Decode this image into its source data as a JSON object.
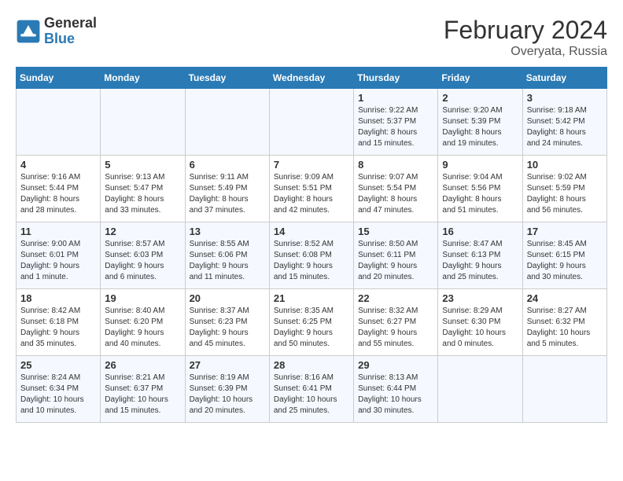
{
  "header": {
    "logo_general": "General",
    "logo_blue": "Blue",
    "month_year": "February 2024",
    "location": "Overyata, Russia"
  },
  "days_of_week": [
    "Sunday",
    "Monday",
    "Tuesday",
    "Wednesday",
    "Thursday",
    "Friday",
    "Saturday"
  ],
  "weeks": [
    [
      {
        "day": "",
        "info": ""
      },
      {
        "day": "",
        "info": ""
      },
      {
        "day": "",
        "info": ""
      },
      {
        "day": "",
        "info": ""
      },
      {
        "day": "1",
        "info": "Sunrise: 9:22 AM\nSunset: 5:37 PM\nDaylight: 8 hours\nand 15 minutes."
      },
      {
        "day": "2",
        "info": "Sunrise: 9:20 AM\nSunset: 5:39 PM\nDaylight: 8 hours\nand 19 minutes."
      },
      {
        "day": "3",
        "info": "Sunrise: 9:18 AM\nSunset: 5:42 PM\nDaylight: 8 hours\nand 24 minutes."
      }
    ],
    [
      {
        "day": "4",
        "info": "Sunrise: 9:16 AM\nSunset: 5:44 PM\nDaylight: 8 hours\nand 28 minutes."
      },
      {
        "day": "5",
        "info": "Sunrise: 9:13 AM\nSunset: 5:47 PM\nDaylight: 8 hours\nand 33 minutes."
      },
      {
        "day": "6",
        "info": "Sunrise: 9:11 AM\nSunset: 5:49 PM\nDaylight: 8 hours\nand 37 minutes."
      },
      {
        "day": "7",
        "info": "Sunrise: 9:09 AM\nSunset: 5:51 PM\nDaylight: 8 hours\nand 42 minutes."
      },
      {
        "day": "8",
        "info": "Sunrise: 9:07 AM\nSunset: 5:54 PM\nDaylight: 8 hours\nand 47 minutes."
      },
      {
        "day": "9",
        "info": "Sunrise: 9:04 AM\nSunset: 5:56 PM\nDaylight: 8 hours\nand 51 minutes."
      },
      {
        "day": "10",
        "info": "Sunrise: 9:02 AM\nSunset: 5:59 PM\nDaylight: 8 hours\nand 56 minutes."
      }
    ],
    [
      {
        "day": "11",
        "info": "Sunrise: 9:00 AM\nSunset: 6:01 PM\nDaylight: 9 hours\nand 1 minute."
      },
      {
        "day": "12",
        "info": "Sunrise: 8:57 AM\nSunset: 6:03 PM\nDaylight: 9 hours\nand 6 minutes."
      },
      {
        "day": "13",
        "info": "Sunrise: 8:55 AM\nSunset: 6:06 PM\nDaylight: 9 hours\nand 11 minutes."
      },
      {
        "day": "14",
        "info": "Sunrise: 8:52 AM\nSunset: 6:08 PM\nDaylight: 9 hours\nand 15 minutes."
      },
      {
        "day": "15",
        "info": "Sunrise: 8:50 AM\nSunset: 6:11 PM\nDaylight: 9 hours\nand 20 minutes."
      },
      {
        "day": "16",
        "info": "Sunrise: 8:47 AM\nSunset: 6:13 PM\nDaylight: 9 hours\nand 25 minutes."
      },
      {
        "day": "17",
        "info": "Sunrise: 8:45 AM\nSunset: 6:15 PM\nDaylight: 9 hours\nand 30 minutes."
      }
    ],
    [
      {
        "day": "18",
        "info": "Sunrise: 8:42 AM\nSunset: 6:18 PM\nDaylight: 9 hours\nand 35 minutes."
      },
      {
        "day": "19",
        "info": "Sunrise: 8:40 AM\nSunset: 6:20 PM\nDaylight: 9 hours\nand 40 minutes."
      },
      {
        "day": "20",
        "info": "Sunrise: 8:37 AM\nSunset: 6:23 PM\nDaylight: 9 hours\nand 45 minutes."
      },
      {
        "day": "21",
        "info": "Sunrise: 8:35 AM\nSunset: 6:25 PM\nDaylight: 9 hours\nand 50 minutes."
      },
      {
        "day": "22",
        "info": "Sunrise: 8:32 AM\nSunset: 6:27 PM\nDaylight: 9 hours\nand 55 minutes."
      },
      {
        "day": "23",
        "info": "Sunrise: 8:29 AM\nSunset: 6:30 PM\nDaylight: 10 hours\nand 0 minutes."
      },
      {
        "day": "24",
        "info": "Sunrise: 8:27 AM\nSunset: 6:32 PM\nDaylight: 10 hours\nand 5 minutes."
      }
    ],
    [
      {
        "day": "25",
        "info": "Sunrise: 8:24 AM\nSunset: 6:34 PM\nDaylight: 10 hours\nand 10 minutes."
      },
      {
        "day": "26",
        "info": "Sunrise: 8:21 AM\nSunset: 6:37 PM\nDaylight: 10 hours\nand 15 minutes."
      },
      {
        "day": "27",
        "info": "Sunrise: 8:19 AM\nSunset: 6:39 PM\nDaylight: 10 hours\nand 20 minutes."
      },
      {
        "day": "28",
        "info": "Sunrise: 8:16 AM\nSunset: 6:41 PM\nDaylight: 10 hours\nand 25 minutes."
      },
      {
        "day": "29",
        "info": "Sunrise: 8:13 AM\nSunset: 6:44 PM\nDaylight: 10 hours\nand 30 minutes."
      },
      {
        "day": "",
        "info": ""
      },
      {
        "day": "",
        "info": ""
      }
    ]
  ]
}
